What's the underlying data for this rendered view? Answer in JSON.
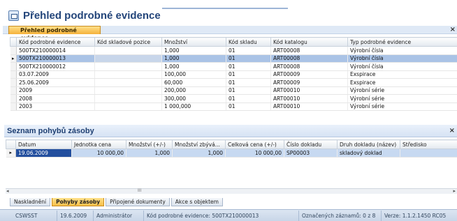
{
  "page_title": "Přehled podrobné evidence",
  "section1": {
    "tab_label": "Přehled podrobné evidence",
    "close": "×",
    "columns": [
      "Kód podrobné evidence",
      "Kód skladové pozice",
      "Množství",
      "Kód skladu",
      "Kód katalogu",
      "Typ podrobné evidence"
    ],
    "rows": [
      [
        "500TX210000014",
        "",
        "1,000",
        "01",
        "ART00008",
        "Výrobní čísla"
      ],
      [
        "500TX210000013",
        "",
        "1,000",
        "01",
        "ART00008",
        "Výrobní čísla"
      ],
      [
        "500TX210000012",
        "",
        "1,000",
        "01",
        "ART00008",
        "Výrobní čísla"
      ],
      [
        "03.07.2009",
        "",
        "100,000",
        "01",
        "ART00009",
        "Exspirace"
      ],
      [
        "25.06.2009",
        "",
        "60,000",
        "01",
        "ART00009",
        "Exspirace"
      ],
      [
        "2009",
        "",
        "200,000",
        "01",
        "ART00010",
        "Výrobní série"
      ],
      [
        "2008",
        "",
        "300,000",
        "01",
        "ART00010",
        "Výrobní série"
      ],
      [
        "2003",
        "",
        "1 000,000",
        "01",
        "ART00010",
        "Výrobní série"
      ]
    ],
    "selected_row": 1
  },
  "section2": {
    "title": "Seznam pohybů zásoby",
    "close": "×",
    "columns": [
      "Datum",
      "Jednotka cena",
      "Množství (+/-)",
      "Množství zbývá...",
      "Celková cena (+/-)",
      "Číslo dokladu",
      "Druh dokladu (název)",
      "Středisko"
    ],
    "rows": [
      [
        "19.06.2009",
        "10 000,00",
        "1,000",
        "1,000",
        "10 000,00",
        "SP00003",
        "skladový doklad",
        ""
      ]
    ],
    "scroll_thumb": "III"
  },
  "tabs": [
    "Naskladnění",
    "Pohyby zásoby",
    "Připojené dokumenty",
    "Akce s objektem"
  ],
  "active_tab": 1,
  "status": {
    "company": "CSWSST",
    "date": "19.6.2009",
    "user": "Administrátor",
    "evidence": "Kód podrobné evidence: 500TX210000013",
    "marked": "Označených záznamů: 0 z 8",
    "version": "Verze: 1.1.2.1450 RC05"
  }
}
